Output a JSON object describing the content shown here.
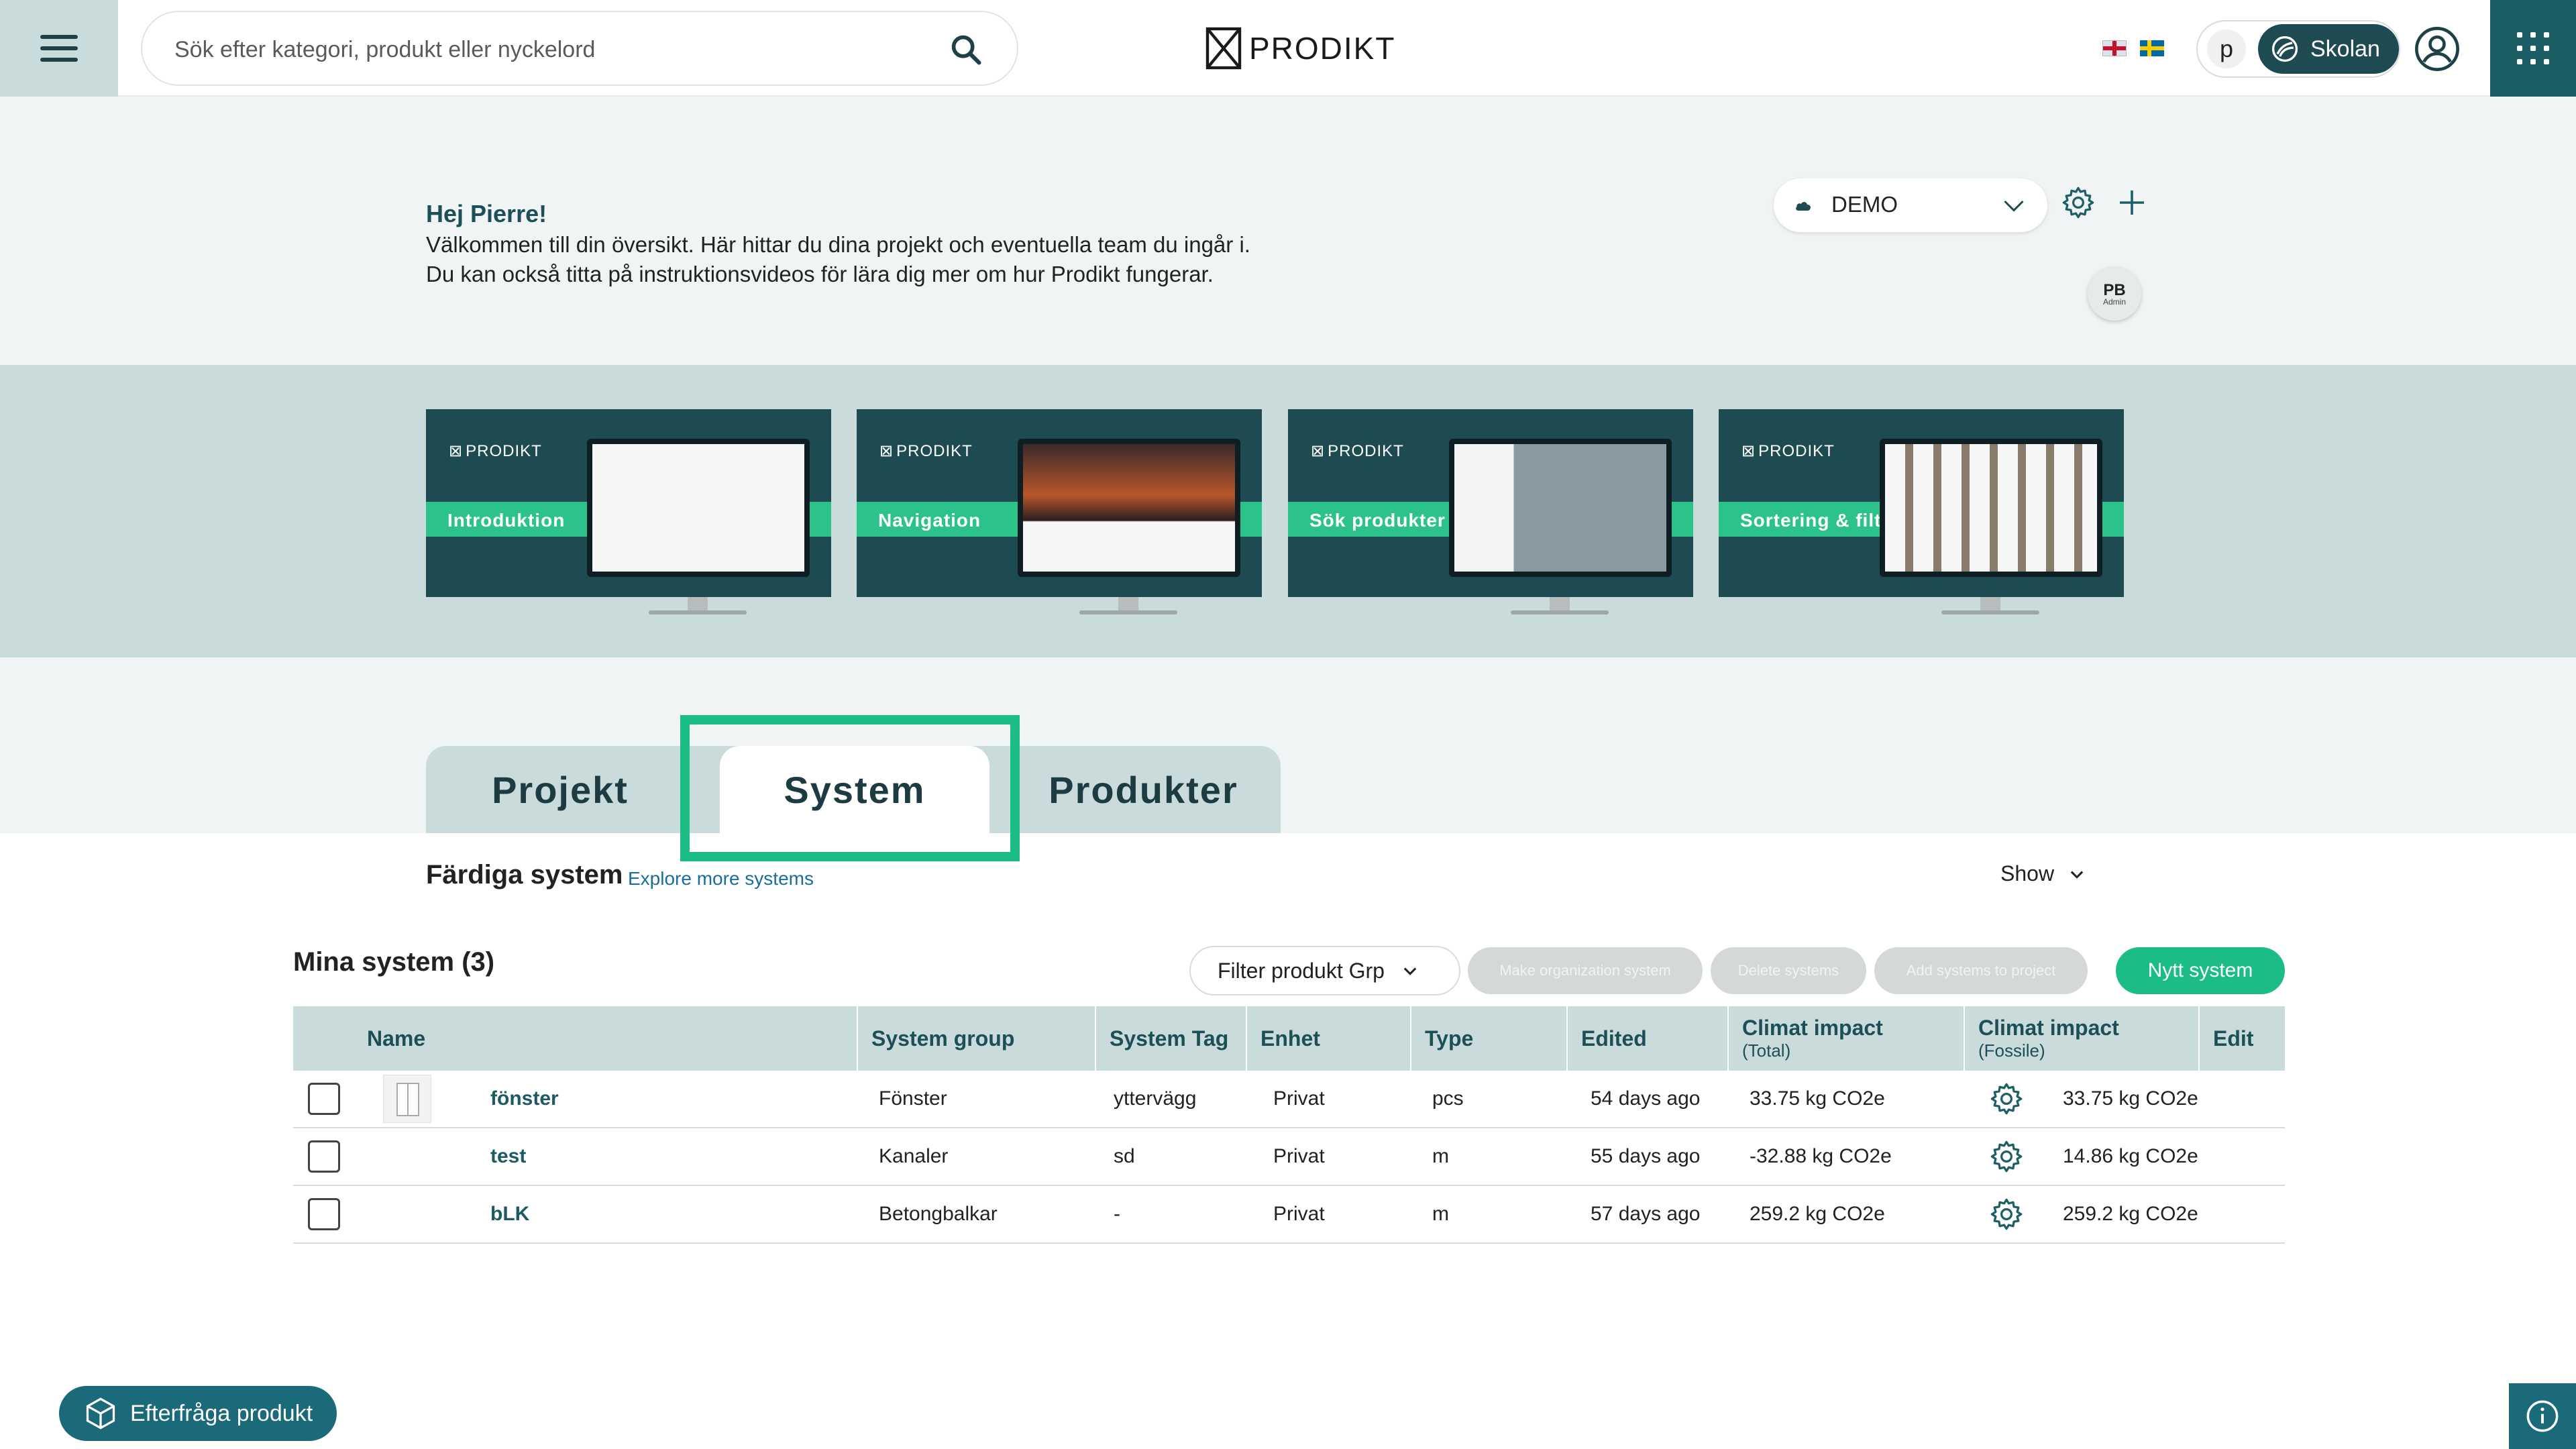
{
  "header": {
    "search_placeholder": "Sök efter kategori, produkt eller nyckelord",
    "logo_text": "PRODIKT",
    "org_initial": "p",
    "org_name": "Skolan"
  },
  "welcome": {
    "greeting": "Hej Pierre!",
    "line1": "Välkommen till din översikt. Här hittar du dina projekt och eventuella team du ingår i.",
    "line2": "Du kan också titta på instruktionsvideos för lära dig mer om hur Prodikt fungerar.",
    "workspace": "DEMO",
    "avatar_initials": "PB",
    "avatar_role": "Admin"
  },
  "videos": [
    {
      "brand": "PRODIKT",
      "label": "Introduktion"
    },
    {
      "brand": "PRODIKT",
      "label": "Navigation"
    },
    {
      "brand": "PRODIKT",
      "label": "Sök produkter"
    },
    {
      "brand": "PRODIKT",
      "label": "Sortering & filter"
    }
  ],
  "tabs": {
    "projekt": "Projekt",
    "system": "System",
    "produkter": "Produkter",
    "active": "System"
  },
  "section": {
    "title": "Färdiga system",
    "explore": "Explore more systems",
    "show": "Show"
  },
  "my_systems": {
    "title": "Mina system (3)",
    "filter": "Filter produkt Grp",
    "btn_make_org": "Make organization system",
    "btn_delete": "Delete systems",
    "btn_add_project": "Add systems to project",
    "btn_new": "Nytt system"
  },
  "table": {
    "headers": {
      "name": "Name",
      "group": "System group",
      "tag": "System Tag",
      "unit": "Enhet",
      "type": "Type",
      "edited": "Edited",
      "climate_total": "Climat impact",
      "climate_total_sub": "(Total)",
      "climate_fossil": "Climat impact",
      "climate_fossil_sub": "(Fossile)",
      "edit": "Edit"
    },
    "rows": [
      {
        "name": "fönster",
        "group": "Fönster",
        "tag": "yttervägg",
        "unit": "Privat",
        "type": "pcs",
        "edited": "54 days ago",
        "total": "33.75 kg CO2e",
        "fossil": "33.75 kg CO2e"
      },
      {
        "name": "test",
        "group": "Kanaler",
        "tag": "sd",
        "unit": "Privat",
        "type": "m",
        "edited": "55 days ago",
        "total": "-32.88 kg CO2e",
        "fossil": "14.86 kg CO2e"
      },
      {
        "name": "bLK",
        "group": "Betongbalkar",
        "tag": "-",
        "unit": "Privat",
        "type": "m",
        "edited": "57 days ago",
        "total": "259.2 kg CO2e",
        "fossil": "259.2 kg CO2e"
      }
    ]
  },
  "footer": {
    "request_product": "Efterfråga produkt"
  },
  "colors": {
    "primary_dark": "#1e4b52",
    "accent_green": "#1bbd85",
    "light_teal": "#c9dbdb"
  },
  "icons": [
    "hamburger-menu-icon",
    "search-icon",
    "prodikt-logo-icon",
    "uk-flag-icon",
    "sweden-flag-icon",
    "org-icon",
    "user-icon",
    "apps-grid-icon",
    "cloud-icon",
    "chevron-down-icon",
    "gear-icon",
    "plus-icon",
    "cube-icon",
    "info-icon"
  ]
}
